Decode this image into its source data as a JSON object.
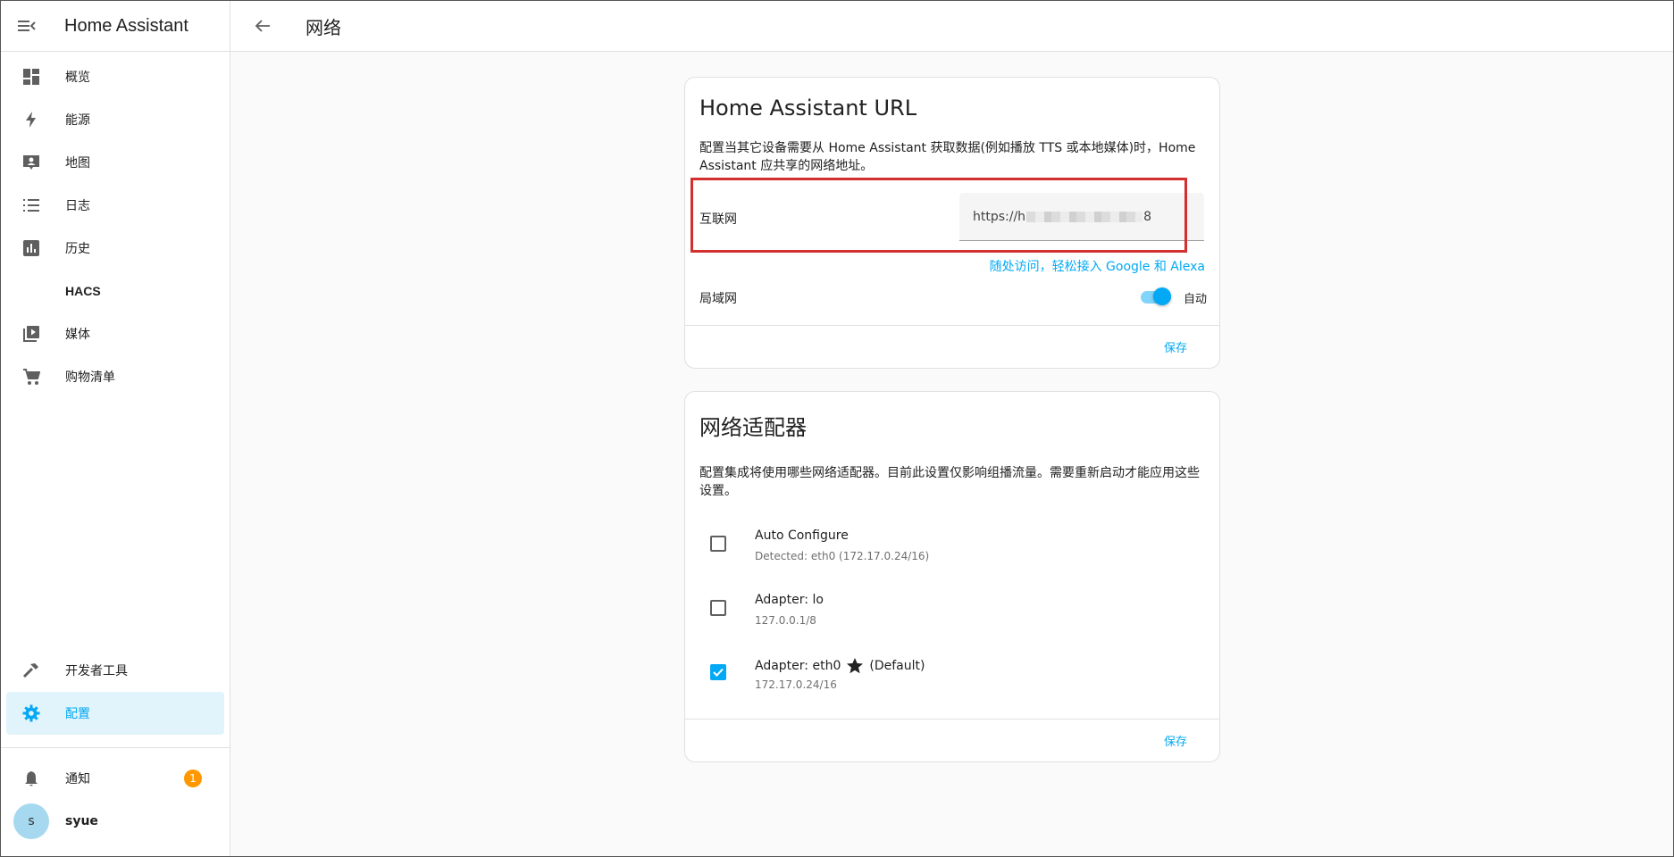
{
  "app": {
    "title": "Home Assistant"
  },
  "sidebar": {
    "items": [
      {
        "label": "概览",
        "icon": "dashboard-icon"
      },
      {
        "label": "能源",
        "icon": "lightning-icon"
      },
      {
        "label": "地图",
        "icon": "map-person-icon"
      },
      {
        "label": "日志",
        "icon": "list-icon"
      },
      {
        "label": "历史",
        "icon": "chart-icon"
      },
      {
        "label": "HACS",
        "icon": ""
      },
      {
        "label": "媒体",
        "icon": "play-box-icon"
      },
      {
        "label": "购物清单",
        "icon": "cart-icon"
      }
    ],
    "bottom": [
      {
        "label": "开发者工具",
        "icon": "hammer-icon"
      },
      {
        "label": "配置",
        "icon": "gear-icon",
        "active": true
      }
    ],
    "notifications": {
      "label": "通知",
      "count": "1"
    },
    "user": {
      "initial": "s",
      "name": "syue"
    }
  },
  "header": {
    "title": "网络"
  },
  "url_card": {
    "title": "Home Assistant URL",
    "description": "配置当其它设备需要从 Home Assistant 获取数据(例如播放 TTS 或本地媒体)时，Home Assistant 应共享的网络地址。",
    "internet_label": "互联网",
    "internet_value_prefix": "https://h",
    "internet_value_suffix": "8",
    "cloud_link": "随处访问，轻松接入 Google 和 Alexa",
    "lan_label": "局域网",
    "lan_toggle_label": "自动",
    "lan_toggle_on": true,
    "save": "保存"
  },
  "adapters_card": {
    "title": "网络适配器",
    "description": "配置集成将使用哪些网络适配器。目前此设置仅影响组播流量。需要重新启动才能应用这些设置。",
    "adapters": [
      {
        "name": "Auto Configure",
        "detail": "Detected: eth0 (172.17.0.24/16)",
        "checked": false
      },
      {
        "name": "Adapter: lo",
        "detail": "127.0.0.1/8",
        "checked": false
      },
      {
        "name": "Adapter: eth0",
        "default_label": "(Default)",
        "detail": "172.17.0.24/16",
        "checked": true
      }
    ],
    "save": "保存"
  },
  "colors": {
    "accent": "#03a9f4",
    "highlight": "#d32f2f",
    "badge": "#ff9800"
  }
}
